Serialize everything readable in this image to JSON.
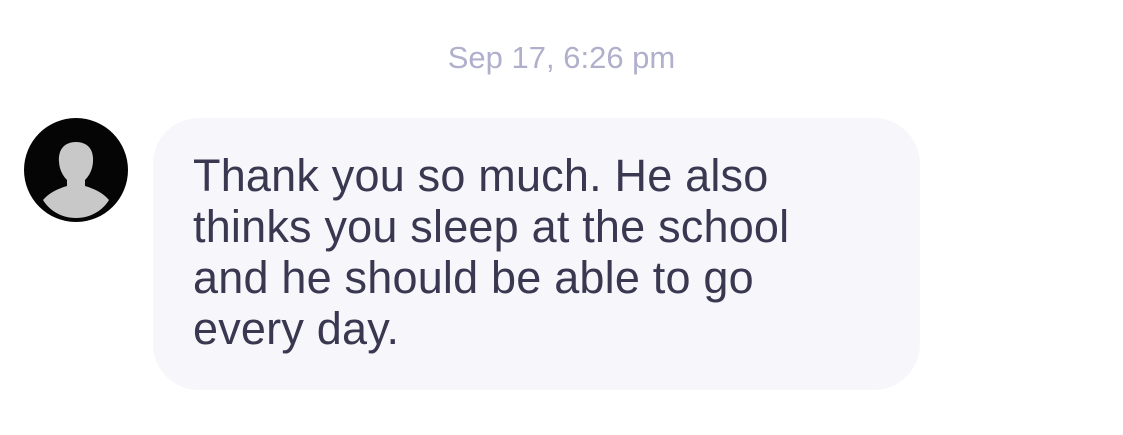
{
  "conversation": {
    "timestamp": "Sep 17, 6:26 pm",
    "message": {
      "text": "Thank you so much. He also\nthinks you sleep at the school\nand he should be able to go\nevery day.",
      "avatar_icon": "default-user-silhouette-icon"
    }
  },
  "colors": {
    "timestamp": "#b1b0cc",
    "bubble_background": "#f6f6fb",
    "message_text": "#3a3851",
    "avatar_background": "#050505",
    "avatar_silhouette": "#c8c8c8"
  }
}
